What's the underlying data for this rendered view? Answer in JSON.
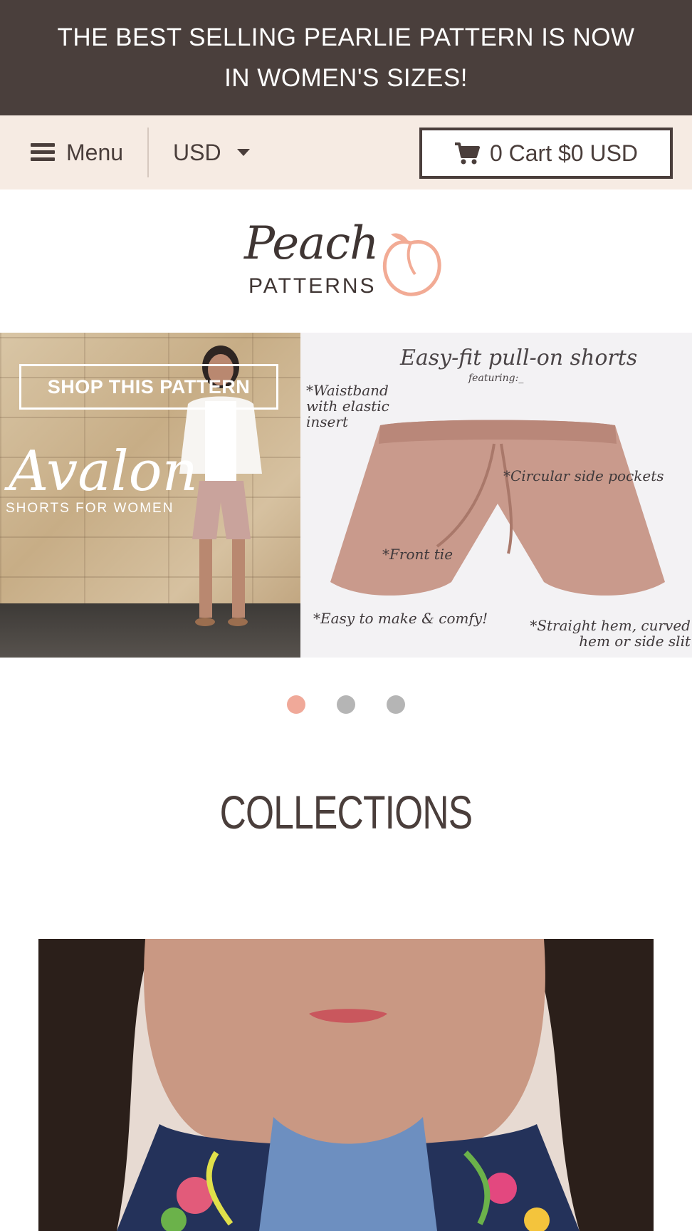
{
  "announcement": {
    "text": "THE BEST SELLING PEARLIE PATTERN IS NOW IN WOMEN'S SIZES!"
  },
  "nav": {
    "menu_label": "Menu",
    "currency_label": "USD",
    "cart_label": "0 Cart $0 USD"
  },
  "logo": {
    "word_top": "Peach",
    "word_bottom": "PATTERNS"
  },
  "slideshow": {
    "shop_button_label": "SHOP THIS PATTERN",
    "pattern_name": "Avalon",
    "pattern_subtitle": "SHORTS FOR WOMEN",
    "feature_title": "Easy-fit pull-on shorts",
    "feature_subtitle": "featuring:_",
    "features": {
      "waistband": "*Waistband with elastic insert",
      "pockets": "*Circular side pockets",
      "tie": "*Front tie",
      "easy": "*Easy to make & comfy!",
      "hem": "*Straight hem, curved hem or side slit"
    },
    "dots": [
      "1",
      "2",
      "3"
    ],
    "active_dot": 0
  },
  "colors": {
    "announcement_bg": "#4a3f3c",
    "nav_bg": "#f6ebe3",
    "accent_peach": "#f0a999",
    "text_dark": "#4a3e3b"
  },
  "collections": {
    "title": "COLLECTIONS"
  }
}
